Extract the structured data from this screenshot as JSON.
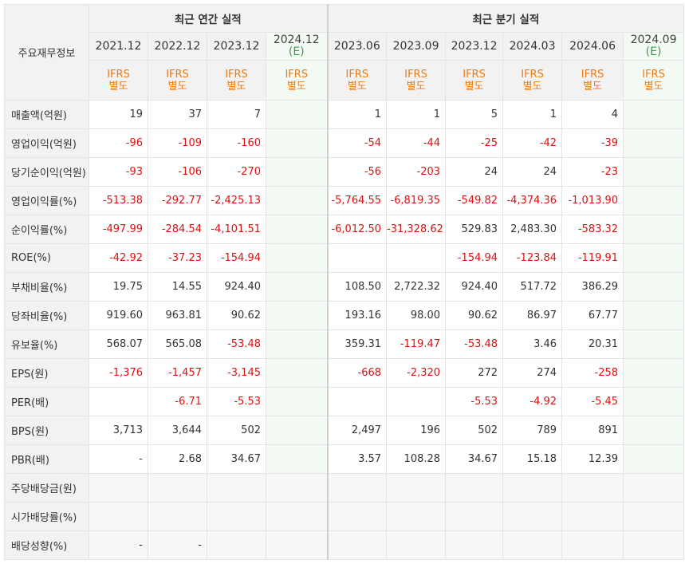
{
  "header": {
    "corner": "주요재무정보",
    "annual_label": "최근 연간 실적",
    "quarter_label": "최근 분기 실적",
    "annual_periods": [
      "2021.12",
      "2022.12",
      "2023.12"
    ],
    "annual_est": {
      "period": "2024.12",
      "e": "(E)"
    },
    "quarter_periods": [
      "2023.06",
      "2023.09",
      "2023.12",
      "2024.03",
      "2024.06"
    ],
    "quarter_est": {
      "period": "2024.09",
      "e": "(E)"
    },
    "ifrs_line1": "IFRS",
    "ifrs_line2": "별도"
  },
  "rows": [
    {
      "label": "매출액(억원)",
      "values": [
        "19",
        "37",
        "7",
        "",
        "1",
        "1",
        "5",
        "1",
        "4",
        ""
      ]
    },
    {
      "label": "영업이익(억원)",
      "values": [
        "-96",
        "-109",
        "-160",
        "",
        "-54",
        "-44",
        "-25",
        "-42",
        "-39",
        ""
      ]
    },
    {
      "label": "당기순이익(억원)",
      "values": [
        "-93",
        "-106",
        "-270",
        "",
        "-56",
        "-203",
        "24",
        "24",
        "-23",
        ""
      ]
    },
    {
      "label": "영업이익률(%)",
      "values": [
        "-513.38",
        "-292.77",
        "-2,425.13",
        "",
        "-5,764.55",
        "-6,819.35",
        "-549.82",
        "-4,374.36",
        "-1,013.90",
        ""
      ]
    },
    {
      "label": "순이익률(%)",
      "values": [
        "-497.99",
        "-284.54",
        "-4,101.51",
        "",
        "-6,012.50",
        "-31,328.62",
        "529.83",
        "2,483.30",
        "-583.32",
        ""
      ]
    },
    {
      "label": "ROE(%)",
      "values": [
        "-42.92",
        "-37.23",
        "-154.94",
        "",
        "",
        "",
        "-154.94",
        "-123.84",
        "-119.91",
        ""
      ]
    },
    {
      "label": "부채비율(%)",
      "values": [
        "19.75",
        "14.55",
        "924.40",
        "",
        "108.50",
        "2,722.32",
        "924.40",
        "517.72",
        "386.29",
        ""
      ]
    },
    {
      "label": "당좌비율(%)",
      "values": [
        "919.60",
        "963.81",
        "90.62",
        "",
        "193.16",
        "98.00",
        "90.62",
        "86.97",
        "67.77",
        ""
      ]
    },
    {
      "label": "유보율(%)",
      "values": [
        "568.07",
        "565.08",
        "-53.48",
        "",
        "359.31",
        "-119.47",
        "-53.48",
        "3.46",
        "20.31",
        ""
      ]
    },
    {
      "label": "EPS(원)",
      "values": [
        "-1,376",
        "-1,457",
        "-3,145",
        "",
        "-668",
        "-2,320",
        "272",
        "274",
        "-258",
        ""
      ]
    },
    {
      "label": "PER(배)",
      "values": [
        "",
        "-6.71",
        "-5.53",
        "",
        "",
        "",
        "-5.53",
        "-4.92",
        "-5.45",
        ""
      ]
    },
    {
      "label": "BPS(원)",
      "values": [
        "3,713",
        "3,644",
        "502",
        "",
        "2,497",
        "196",
        "502",
        "789",
        "891",
        ""
      ]
    },
    {
      "label": "PBR(배)",
      "values": [
        "-",
        "2.68",
        "34.67",
        "",
        "3.57",
        "108.28",
        "34.67",
        "15.18",
        "12.39",
        ""
      ]
    },
    {
      "label": "주당배당금(원)",
      "values": [
        "",
        "",
        "",
        "",
        "",
        "",
        "",
        "",
        "",
        ""
      ]
    },
    {
      "label": "시가배당률(%)",
      "values": [
        "",
        "",
        "",
        "",
        "",
        "",
        "",
        "",
        "",
        ""
      ]
    },
    {
      "label": "배당성향(%)",
      "values": [
        "-",
        "-",
        "",
        "",
        "",
        "",
        "",
        "",
        "",
        ""
      ]
    }
  ]
}
